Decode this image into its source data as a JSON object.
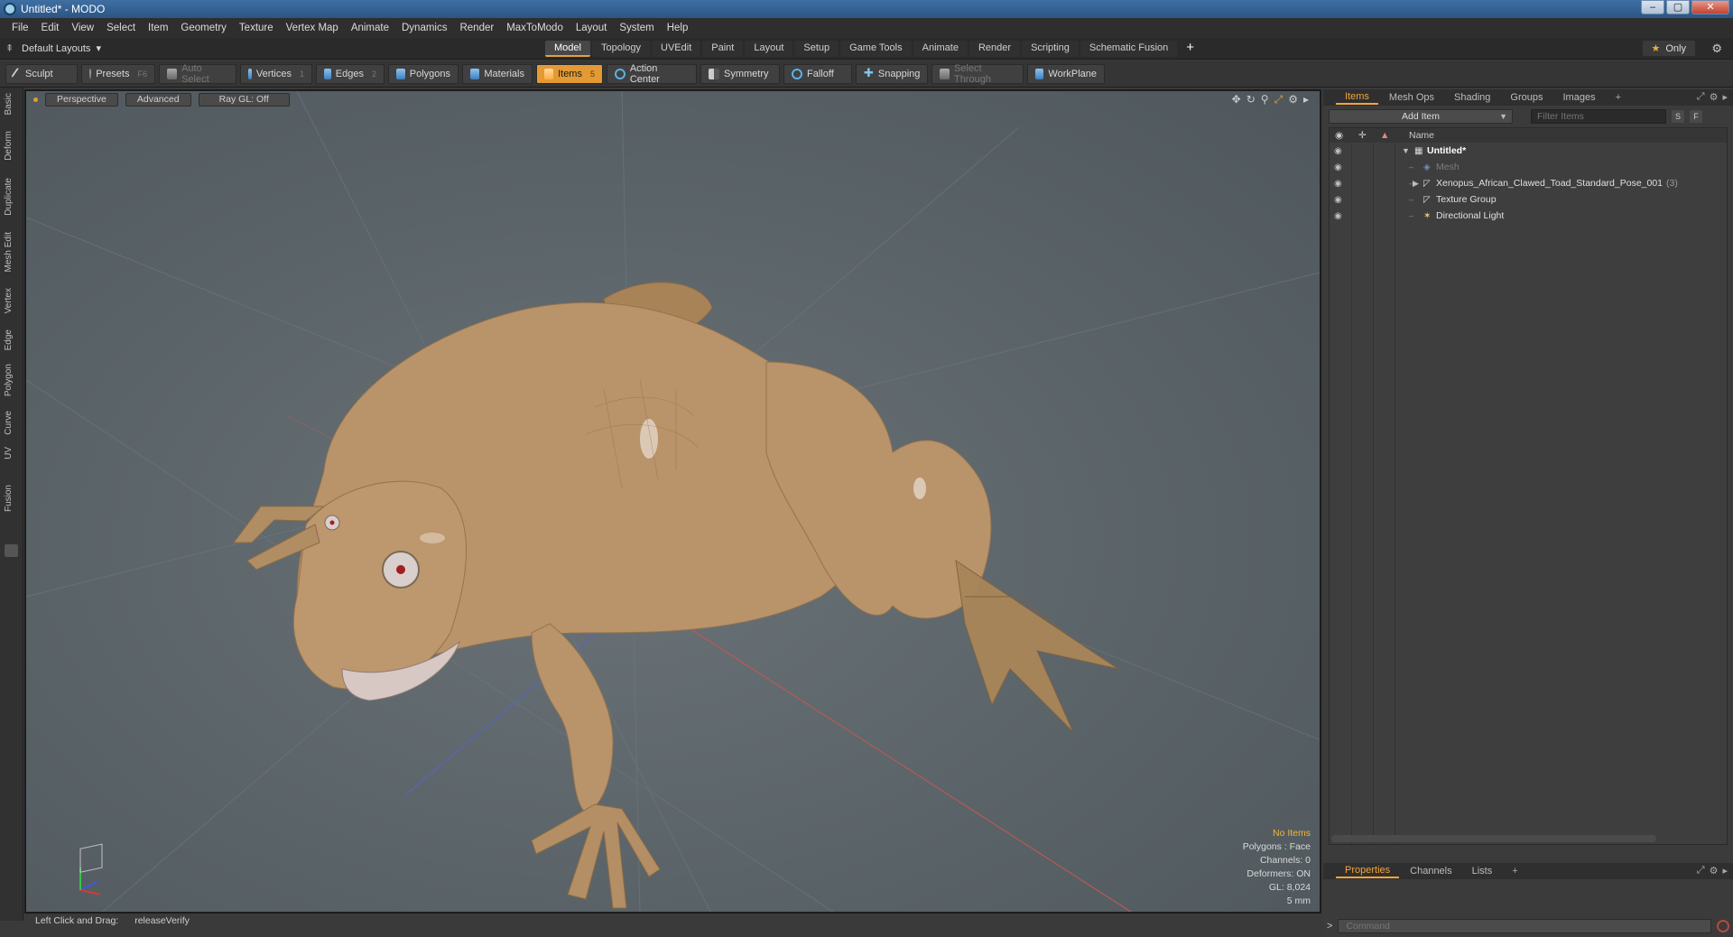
{
  "window": {
    "title": "Untitled* - MODO",
    "min": "–",
    "max": "▢",
    "close": "✕"
  },
  "menu": [
    "File",
    "Edit",
    "View",
    "Select",
    "Item",
    "Geometry",
    "Texture",
    "Vertex Map",
    "Animate",
    "Dynamics",
    "Render",
    "MaxToModo",
    "Layout",
    "System",
    "Help"
  ],
  "layout": {
    "label": "Default Layouts",
    "caret": "▾"
  },
  "tabs": [
    "Model",
    "Topology",
    "UVEdit",
    "Paint",
    "Layout",
    "Setup",
    "Game Tools",
    "Animate",
    "Render",
    "Scripting",
    "Schematic Fusion"
  ],
  "active_tab": "Model",
  "tab_add": "+",
  "only_label": "Only",
  "toolbar": {
    "sculpt": "Sculpt",
    "presets": "Presets",
    "presets_key": "F6",
    "auto_select": "Auto Select",
    "vertices": "Vertices",
    "vertices_key": "1",
    "edges": "Edges",
    "edges_key": "2",
    "polygons": "Polygons",
    "materials": "Materials",
    "items": "Items",
    "items_key": "5",
    "action_center": "Action Center",
    "symmetry": "Symmetry",
    "falloff": "Falloff",
    "snapping": "Snapping",
    "select_through": "Select Through",
    "workplane": "WorkPlane"
  },
  "left_palette": [
    "Basic",
    "Deform",
    "Duplicate",
    "Mesh Edit",
    "Vertex",
    "Edge",
    "Polygon",
    "Curve",
    "UV",
    "Fusion"
  ],
  "viewport": {
    "view": "Perspective",
    "mode": "Advanced",
    "raygl": "Ray GL: Off",
    "stats": {
      "items": "No Items",
      "polygons": "Polygons : Face",
      "channels": "Channels: 0",
      "deformers": "Deformers: ON",
      "gl": "GL: 8,024",
      "scale": "5 mm"
    }
  },
  "status": {
    "label": "Left Click and Drag:",
    "value": "releaseVerify"
  },
  "right_panel": {
    "tabs": [
      "Items",
      "Mesh Ops",
      "Shading",
      "Groups",
      "Images"
    ],
    "active_tab": "Items",
    "add_item": "Add Item",
    "filter_placeholder": "Filter Items",
    "s_btn": "S",
    "f_btn": "F",
    "name_header": "Name",
    "tree": [
      {
        "label": "Untitled*",
        "level": 0,
        "expanded": true
      },
      {
        "label": "Mesh",
        "level": 1
      },
      {
        "label": "Xenopus_African_Clawed_Toad_Standard_Pose_001",
        "count": "(3)",
        "level": 1,
        "expandable": true
      },
      {
        "label": "Texture Group",
        "level": 1
      },
      {
        "label": "Directional Light",
        "level": 1
      }
    ],
    "bottom_tabs": [
      "Properties",
      "Channels",
      "Lists"
    ],
    "bottom_active": "Properties",
    "command_placeholder": "Command"
  },
  "colors": {
    "accent": "#e39a34",
    "viewport_bg": "#5a6368",
    "toad": "#b9936a"
  }
}
